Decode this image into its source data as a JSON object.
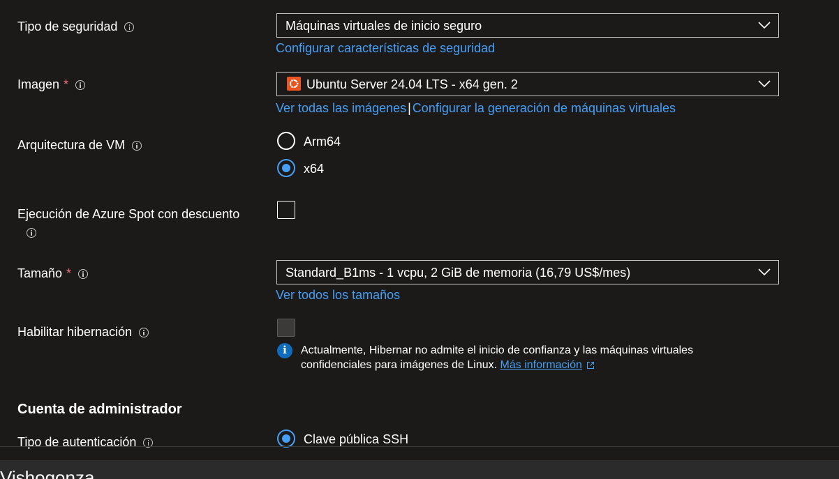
{
  "fields": {
    "security_type": {
      "label": "Tipo de seguridad",
      "value": "Máquinas virtuales de inicio seguro",
      "link": "Configurar características de seguridad"
    },
    "image": {
      "label": "Imagen",
      "required_mark": "*",
      "icon": "ubuntu-logo",
      "value": "Ubuntu Server 24.04 LTS - x64 gen. 2",
      "link_all": "Ver todas las imágenes",
      "separator": "|",
      "link_generation": "Configurar la generación de máquinas virtuales"
    },
    "vm_architecture": {
      "label": "Arquitectura de VM",
      "options": [
        {
          "label": "Arm64",
          "selected": false
        },
        {
          "label": "x64",
          "selected": true
        }
      ]
    },
    "azure_spot": {
      "label": "Ejecución de Azure Spot con descuento",
      "checked": false
    },
    "size": {
      "label": "Tamaño",
      "required_mark": "*",
      "value": "Standard_B1ms - 1 vcpu, 2 GiB de memoria (16,79 US$/mes)",
      "link": "Ver todos los tamaños"
    },
    "hibernation": {
      "label": "Habilitar hibernación",
      "checked": false,
      "disabled": true,
      "note_line1": "Actualmente, Hibernar no admite el inicio de confianza y las máquinas virtuales",
      "note_line2": "confidenciales para imágenes de Linux.",
      "note_link": "Más información"
    }
  },
  "admin_section": {
    "title": "Cuenta de administrador",
    "auth_type": {
      "label": "Tipo de autenticación",
      "selected_option": "Clave pública SSH"
    }
  },
  "bottom_bar": {
    "text": "Vishogonza"
  },
  "colors": {
    "background": "#1b1a19",
    "link": "#479ef5",
    "required": "#f1707b",
    "info_blue": "#0f6cbd",
    "ubuntu": "#e95420"
  }
}
